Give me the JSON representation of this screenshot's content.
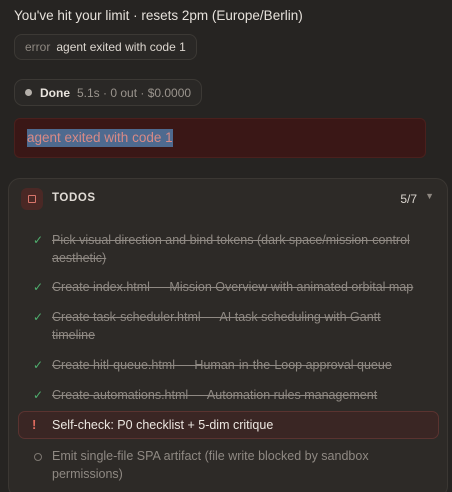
{
  "status": {
    "limit_text": "You've hit your limit · resets 2pm (Europe/Berlin)",
    "error_tag": "error",
    "error_message": "agent exited with code 1",
    "done_label": "Done",
    "done_stats": "5.1s · 0 out · $0.0000"
  },
  "error_box": {
    "selected_text": "agent exited with code 1"
  },
  "todos": {
    "title": "TODOS",
    "count": "5/7",
    "items": [
      {
        "state": "done",
        "icon": "check-icon",
        "text": "Pick visual direction and bind tokens (dark space/mission-control aesthetic)"
      },
      {
        "state": "done",
        "icon": "check-icon",
        "text": "Create index.html — Mission Overview with animated orbital map"
      },
      {
        "state": "done",
        "icon": "check-icon",
        "text": "Create task-scheduler.html — AI task scheduling with Gantt timeline"
      },
      {
        "state": "done",
        "icon": "check-icon",
        "text": "Create hitl-queue.html — Human-in-the-Loop approval queue"
      },
      {
        "state": "done",
        "icon": "check-icon",
        "text": "Create automations.html — Automation rules management"
      },
      {
        "state": "active",
        "icon": "alert-icon",
        "text": "Self-check: P0 checklist + 5-dim critique"
      },
      {
        "state": "pending",
        "icon": "circle-icon",
        "text": "Emit single-file SPA artifact (file write blocked by sandbox permissions)"
      }
    ]
  },
  "colors": {
    "check": "#4fae6d",
    "alert": "#e06b5f",
    "error_bg": "#3a1716",
    "selection": "#4e6a8f"
  }
}
